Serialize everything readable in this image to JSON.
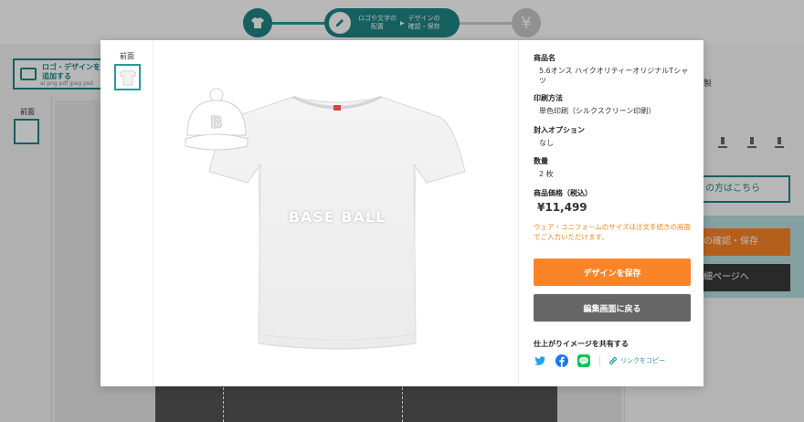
{
  "steps": {
    "pill_line1": "ロゴや文字の",
    "pill_line2": "配置",
    "pill_line3": "デザインの",
    "pill_line4": "確認・保存",
    "pill_arrow": "▶",
    "yen_glyph": "¥"
  },
  "editor": {
    "upload_line1": "ロゴ・デザインを",
    "upload_line2": "追加する",
    "upload_formats": "ai png pdf jpeg psd",
    "side_label": "前面",
    "right_small": "製",
    "right_outline_btn": "の方はこちら",
    "right_orange_btn": "の確認・保存",
    "right_dark_btn": "細ページへ"
  },
  "modal": {
    "view_label": "前面",
    "print": {
      "cap_letter": "B",
      "text": "BASE BALL"
    },
    "product_name_label": "商品名",
    "product_name": "5.6オンス ハイクオリティーオリジナルTシャツ",
    "print_method_label": "印刷方法",
    "print_method": "単色印刷（シルクスクリーン印刷）",
    "packing_label": "封入オプション",
    "packing": "なし",
    "quantity_label": "数量",
    "quantity": "2 枚",
    "price_label": "商品価格（税込）",
    "price": "¥11,499",
    "notice": "ウェア・ユニフォームのサイズは注文手続きの画面でご入力いただけます。",
    "save_button": "デザインを保存",
    "back_button": "編集画面に戻る",
    "share_title": "仕上がりイメージを共有する",
    "share_icons": [
      "twitter-icon",
      "facebook-icon",
      "line-icon"
    ],
    "copy_link": "リンクをコピー"
  },
  "colors": {
    "teal": "#1f8585",
    "orange": "#fb8429",
    "gray_button": "#666666",
    "notice": "#f08a1e"
  }
}
